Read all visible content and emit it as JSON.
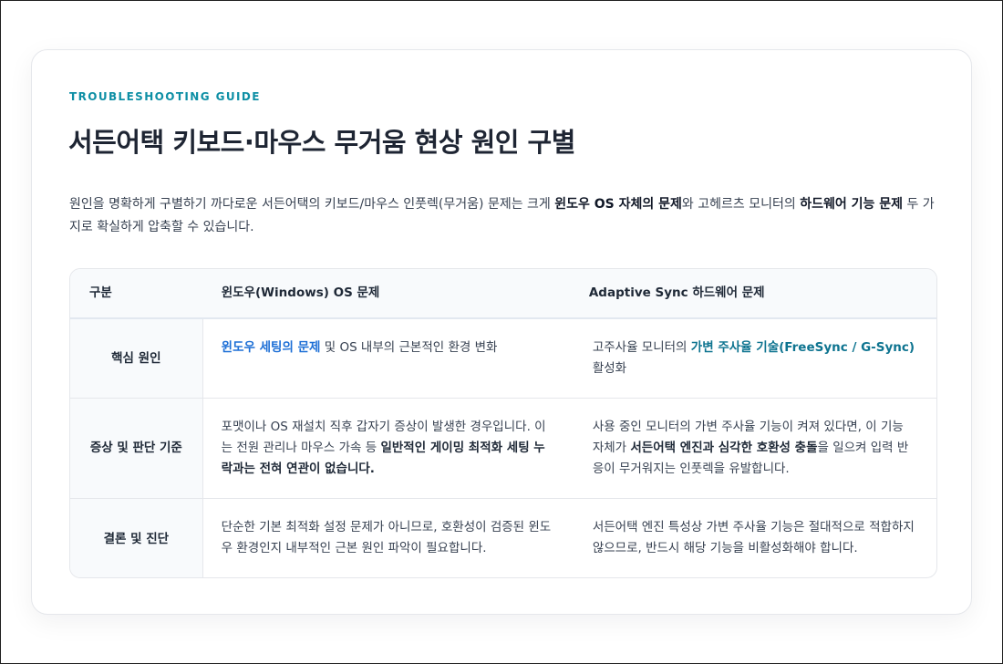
{
  "header": {
    "eyebrow": "TROUBLESHOOTING GUIDE",
    "title": "서든어택 키보드·마우스 무거움 현상 원인 구별"
  },
  "intro": {
    "part1": "원인을 명확하게 구별하기 까다로운 서든어택의 키보드/마우스 인풋렉(무거움) 문제는 크게 ",
    "bold1": "윈도우 OS 자체의 문제",
    "part2": "와 고헤르츠 모니터의 ",
    "bold2": "하드웨어 기능 문제",
    "part3": " 두 가지로 확실하게 압축할 수 있습니다."
  },
  "table": {
    "headers": [
      "구분",
      "윈도우(Windows) OS 문제",
      "Adaptive Sync 하드웨어 문제"
    ],
    "rows": [
      {
        "label": "핵심 원인",
        "os": {
          "hl": "윈도우 세팅의 문제",
          "rest": " 및 OS 내부의 근본적인 환경 변화"
        },
        "hw": {
          "pre": "고주사율 모니터의 ",
          "hl": "가변 주사율 기술(FreeSync / G-Sync)",
          "post": " 활성화"
        }
      },
      {
        "label": "증상 및 판단 기준",
        "os": {
          "pre": "포맷이나 OS 재설치 직후 갑자기 증상이 발생한 경우입니다. 이는 전원 관리나 마우스 가속 등 ",
          "bold": "일반적인 게이밍 최적화 세팅 누락과는 전혀 연관이 없습니다."
        },
        "hw": {
          "pre": "사용 중인 모니터의 가변 주사율 기능이 켜져 있다면, 이 기능 자체가 ",
          "bold": "서든어택 엔진과 심각한 호환성 충돌",
          "post": "을 일으켜 입력 반응이 무거워지는 인풋렉을 유발합니다."
        }
      },
      {
        "label": "결론 및 진단",
        "os": "단순한 기본 최적화 설정 문제가 아니므로, 호환성이 검증된 윈도우 환경인지 내부적인 근본 원인 파악이 필요합니다.",
        "hw": "서든어택 엔진 특성상 가변 주사율 기능은 절대적으로 적합하지 않으므로, 반드시 해당 기능을 비활성화해야 합니다."
      }
    ]
  }
}
